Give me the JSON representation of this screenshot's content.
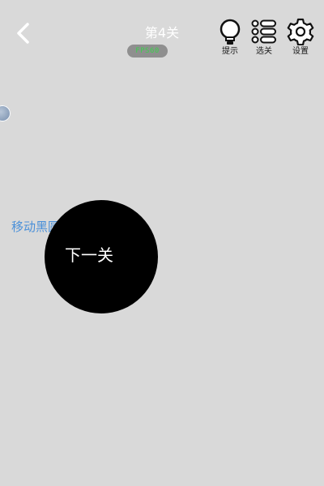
{
  "header": {
    "level_title": "第4关",
    "status_pill": "FPS60"
  },
  "toolbar": {
    "hint_label": "提示",
    "levels_label": "选关",
    "settings_label": "设置"
  },
  "puzzle": {
    "instruction": "移动黑圆形，找到",
    "next_level_label": "下一关"
  },
  "colors": {
    "background": "#d9d9d9",
    "instruction": "#4a90d9",
    "circle": "#000000",
    "status_pill_bg": "#8f8f8f",
    "status_pill_text": "#3bd24c"
  },
  "icons": {
    "back": "chevron-left-icon",
    "hint": "lightbulb-icon",
    "levels": "list-icon",
    "settings": "gear-icon"
  }
}
